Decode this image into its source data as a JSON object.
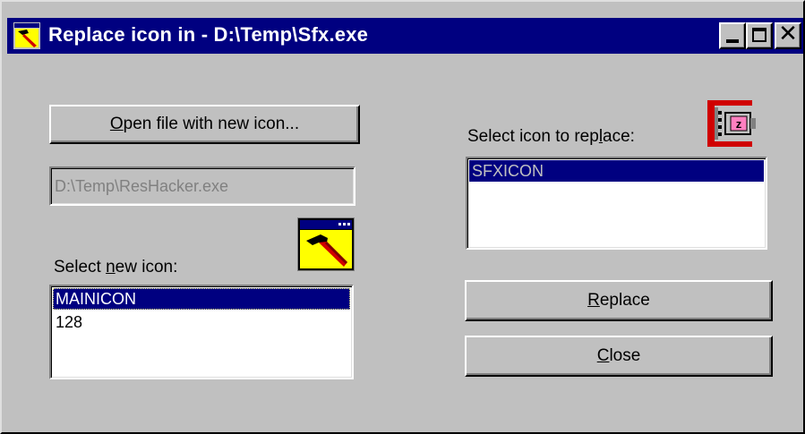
{
  "window": {
    "title": "Replace icon in - D:\\Temp\\Sfx.exe",
    "title_bg": "#000080",
    "face": "#c0c0c0"
  },
  "titlebar_buttons": {
    "minimize_icon": "minimize-icon",
    "maximize_icon": "maximize-icon",
    "close_icon": "close-icon",
    "close_glyph": "✕"
  },
  "left": {
    "open_button": {
      "accel": "O",
      "rest": "pen file with new icon..."
    },
    "file_path": "D:\\Temp\\ResHacker.exe",
    "select_label": {
      "pre": "Select ",
      "accel": "n",
      "post": "ew icon:"
    },
    "icons": [
      "MAINICON",
      "128"
    ],
    "selected_index": 0,
    "preview_icon": "hammer-icon"
  },
  "right": {
    "select_label": {
      "pre": "Select icon to rep",
      "accel": "l",
      "post": "ace:"
    },
    "icons": [
      "SFXICON"
    ],
    "selected_index": 0,
    "preview_icon": "clamp-icon",
    "replace_button": {
      "accel": "R",
      "rest": "eplace"
    },
    "close_button": {
      "accel": "C",
      "rest": "lose"
    }
  }
}
